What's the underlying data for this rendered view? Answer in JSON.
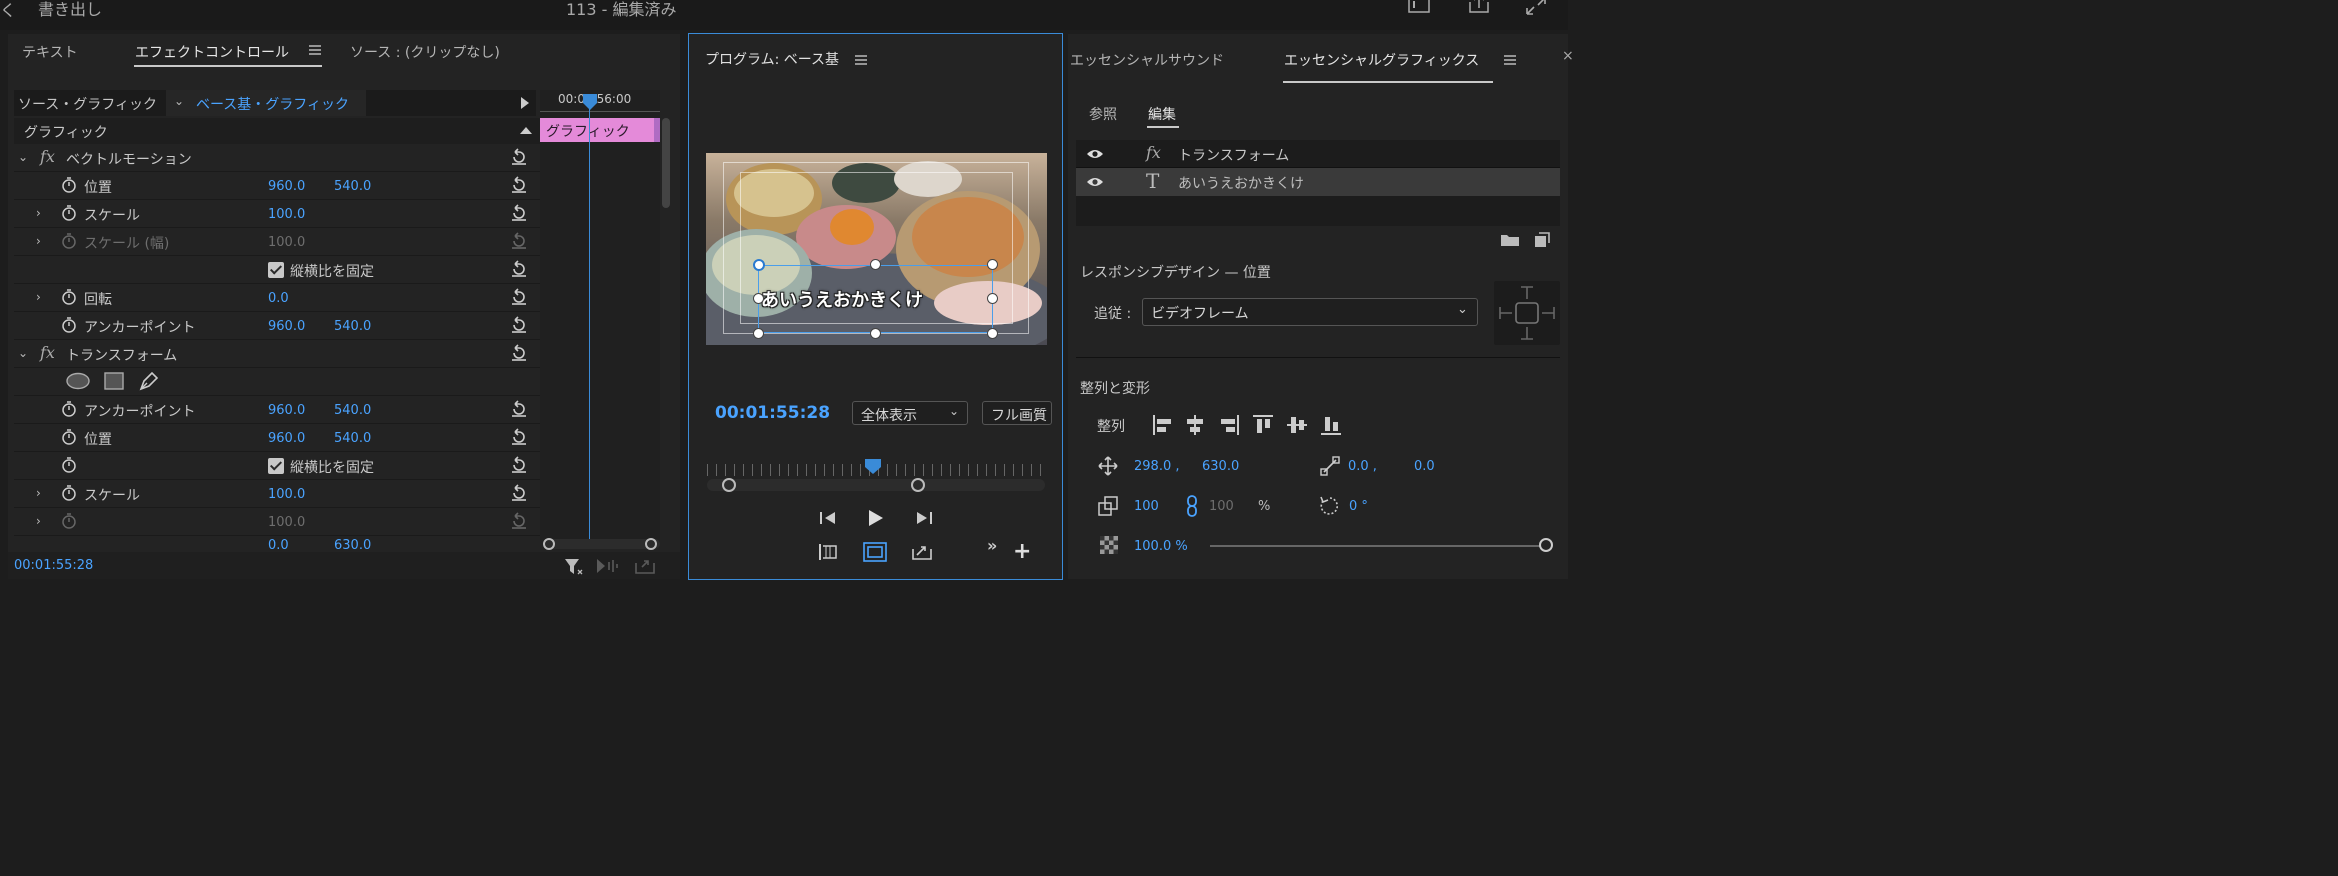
{
  "topbar": {
    "export_label": "書き出し",
    "project_title": "113 - 編集済み"
  },
  "left_panel": {
    "tabs": [
      {
        "label": "テキスト"
      },
      {
        "label": "エフェクトコントロール"
      },
      {
        "label": "ソース : (クリップなし)"
      }
    ],
    "source_label": "ソース・グラフィック",
    "clip_label": "ベース基・グラフィック",
    "timecode_ruler": "00:01:56:00",
    "clip_bar_label": "グラフィック",
    "section_label": "グラフィック",
    "rows": [
      {
        "label": "ベクトルモーション"
      },
      {
        "label": "位置",
        "v1": "960.0",
        "v2": "540.0"
      },
      {
        "label": "スケール",
        "v1": "100.0"
      },
      {
        "label": "スケール (幅)",
        "v1": "100.0"
      },
      {
        "label": "縦横比を固定"
      },
      {
        "label": "回転",
        "v1": "0.0"
      },
      {
        "label": "アンカーポイント",
        "v1": "960.0",
        "v2": "540.0"
      },
      {
        "label": "トランスフォーム"
      },
      {
        "label": ""
      },
      {
        "label": "アンカーポイント",
        "v1": "960.0",
        "v2": "540.0"
      },
      {
        "label": "位置",
        "v1": "960.0",
        "v2": "540.0"
      },
      {
        "label": "縦横比を固定"
      },
      {
        "label": "スケール",
        "v1": "100.0"
      },
      {
        "label": "",
        "v1": "100.0"
      },
      {
        "label": "",
        "v1": "0.0",
        "v2": "630.0"
      }
    ],
    "bottom_timecode": "00:01:55:28"
  },
  "program": {
    "title": "プログラム: ベース基",
    "caption": "あいうえおかきくけ",
    "timecode": "00:01:55:28",
    "zoom_select": "全体表示",
    "quality_select": "フル画質"
  },
  "right_panel": {
    "tabs": [
      {
        "label": "エッセンシャルサウンド"
      },
      {
        "label": "エッセンシャルグラフィックス"
      }
    ],
    "subtabs": [
      {
        "label": "参照"
      },
      {
        "label": "編集"
      }
    ],
    "layers": [
      {
        "label": "トランスフォーム"
      },
      {
        "label": "あいうえおかきくけ"
      }
    ],
    "responsive_title": "レスポンシブデザイン — 位置",
    "follow_label": "追従 :",
    "follow_value": "ビデオフレーム",
    "align_title": "整列と変形",
    "align_label": "整列",
    "position_x": "298.0 ,",
    "position_y": "630.0",
    "anchor_x": "0.0 ,",
    "anchor_y": "0.0",
    "scale": "100",
    "scale_width": "100",
    "percent": "%",
    "rotation": "0 °",
    "opacity": "100.0 %"
  },
  "colors": {
    "accent": "#4aa3ff",
    "clip": "#e48ad9",
    "panel_border": "#3a8bd8"
  }
}
